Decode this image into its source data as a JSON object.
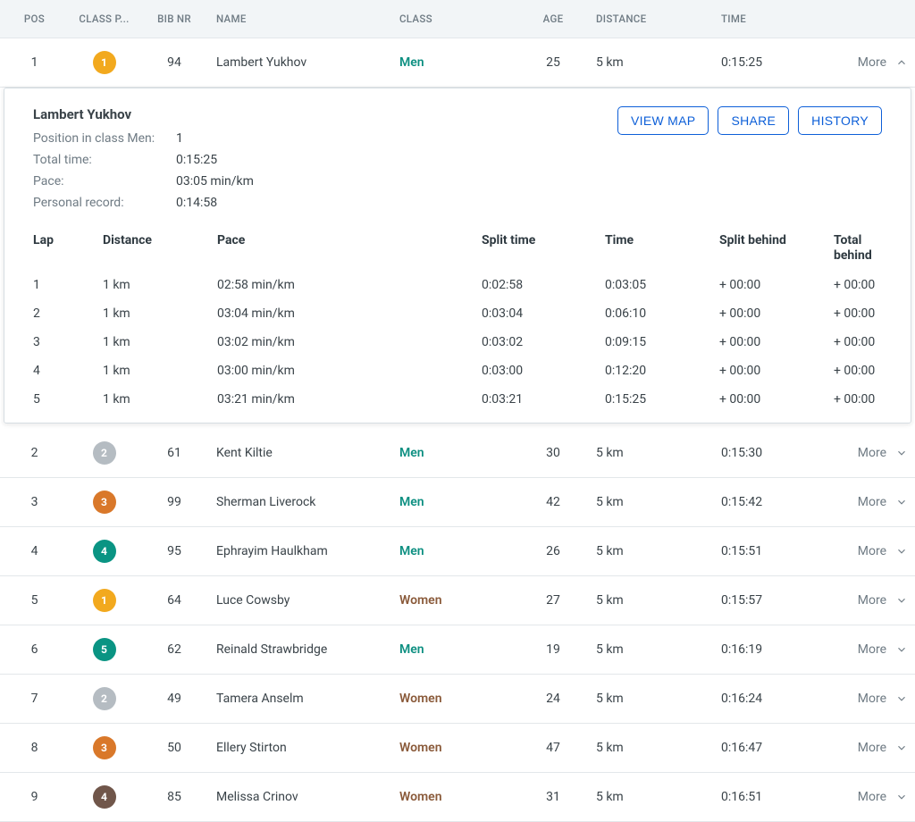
{
  "headers": {
    "pos": "POS",
    "class_pos": "CLASS P...",
    "bib": "BIB NR",
    "name": "NAME",
    "class": "CLASS",
    "age": "AGE",
    "distance": "DISTANCE",
    "time": "TIME"
  },
  "more_label": "More",
  "results": [
    {
      "pos": "1",
      "class_pos": "1",
      "badge": "gold",
      "bib": "94",
      "name": "Lambert Yukhov",
      "class": "Men",
      "age": "25",
      "distance": "5 km",
      "time": "0:15:25",
      "expanded": true
    },
    {
      "pos": "2",
      "class_pos": "2",
      "badge": "silver",
      "bib": "61",
      "name": "Kent Kiltie",
      "class": "Men",
      "age": "30",
      "distance": "5 km",
      "time": "0:15:30"
    },
    {
      "pos": "3",
      "class_pos": "3",
      "badge": "bronze",
      "bib": "99",
      "name": "Sherman Liverock",
      "class": "Men",
      "age": "42",
      "distance": "5 km",
      "time": "0:15:42"
    },
    {
      "pos": "4",
      "class_pos": "4",
      "badge": "teal",
      "bib": "95",
      "name": "Ephrayim Haulkham",
      "class": "Men",
      "age": "26",
      "distance": "5 km",
      "time": "0:15:51"
    },
    {
      "pos": "5",
      "class_pos": "1",
      "badge": "gold",
      "bib": "64",
      "name": "Luce Cowsby",
      "class": "Women",
      "age": "27",
      "distance": "5 km",
      "time": "0:15:57"
    },
    {
      "pos": "6",
      "class_pos": "5",
      "badge": "teal",
      "bib": "62",
      "name": "Reinald Strawbridge",
      "class": "Men",
      "age": "19",
      "distance": "5 km",
      "time": "0:16:19"
    },
    {
      "pos": "7",
      "class_pos": "2",
      "badge": "silver",
      "bib": "49",
      "name": "Tamera Anselm",
      "class": "Women",
      "age": "24",
      "distance": "5 km",
      "time": "0:16:24"
    },
    {
      "pos": "8",
      "class_pos": "3",
      "badge": "bronze",
      "bib": "50",
      "name": "Ellery Stirton",
      "class": "Women",
      "age": "47",
      "distance": "5 km",
      "time": "0:16:47"
    },
    {
      "pos": "9",
      "class_pos": "4",
      "badge": "brown",
      "bib": "85",
      "name": "Melissa Crinov",
      "class": "Women",
      "age": "31",
      "distance": "5 km",
      "time": "0:16:51"
    }
  ],
  "detail": {
    "name": "Lambert Yukhov",
    "labels": {
      "class_pos": "Position in class Men:",
      "total_time": "Total time:",
      "pace": "Pace:",
      "pr": "Personal record:"
    },
    "values": {
      "class_pos": "1",
      "total_time": "0:15:25",
      "pace": "03:05 min/km",
      "pr": "0:14:58"
    },
    "actions": {
      "map": "VIEW MAP",
      "share": "SHARE",
      "history": "HISTORY"
    },
    "lap_headers": {
      "lap": "Lap",
      "distance": "Distance",
      "pace": "Pace",
      "split": "Split time",
      "time": "Time",
      "split_behind": "Split behind",
      "total_behind": "Total behind"
    },
    "laps": [
      {
        "lap": "1",
        "distance": "1 km",
        "pace": "02:58 min/km",
        "bar": 1.0,
        "split": "0:02:58",
        "time": "0:03:05",
        "split_behind": "+ 00:00",
        "total_behind": "+ 00:00"
      },
      {
        "lap": "2",
        "distance": "1 km",
        "pace": "03:04 min/km",
        "bar": 1.0,
        "split": "0:03:04",
        "time": "0:06:10",
        "split_behind": "+ 00:00",
        "total_behind": "+ 00:00"
      },
      {
        "lap": "3",
        "distance": "1 km",
        "pace": "03:02 min/km",
        "bar": 1.0,
        "split": "0:03:02",
        "time": "0:09:15",
        "split_behind": "+ 00:00",
        "total_behind": "+ 00:00"
      },
      {
        "lap": "4",
        "distance": "1 km",
        "pace": "03:00 min/km",
        "bar": 1.0,
        "split": "0:03:00",
        "time": "0:12:20",
        "split_behind": "+ 00:00",
        "total_behind": "+ 00:00"
      },
      {
        "lap": "5",
        "distance": "1 km",
        "pace": "03:21 min/km",
        "bar": 0.88,
        "split": "0:03:21",
        "time": "0:15:25",
        "split_behind": "+ 00:00",
        "total_behind": "+ 00:00"
      }
    ]
  }
}
